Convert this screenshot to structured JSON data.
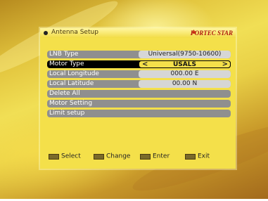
{
  "header": {
    "title": "Antenna Setup",
    "brand": "FORTEC STAR"
  },
  "menu": {
    "items": [
      {
        "label": "LNB Type",
        "value": "Universal(9750-10600)"
      },
      {
        "label": "Motor Type",
        "value": "USALS",
        "selected": true
      },
      {
        "label": "Local Longitude",
        "value": "000.00 E"
      },
      {
        "label": "Local Latitude",
        "value": "00.00 N"
      },
      {
        "label": "Delete All"
      },
      {
        "label": "Motor Setting"
      },
      {
        "label": "Limit setup"
      }
    ]
  },
  "footer": {
    "select": "Select",
    "change": "Change",
    "enter": "Enter",
    "exit": "Exit"
  }
}
